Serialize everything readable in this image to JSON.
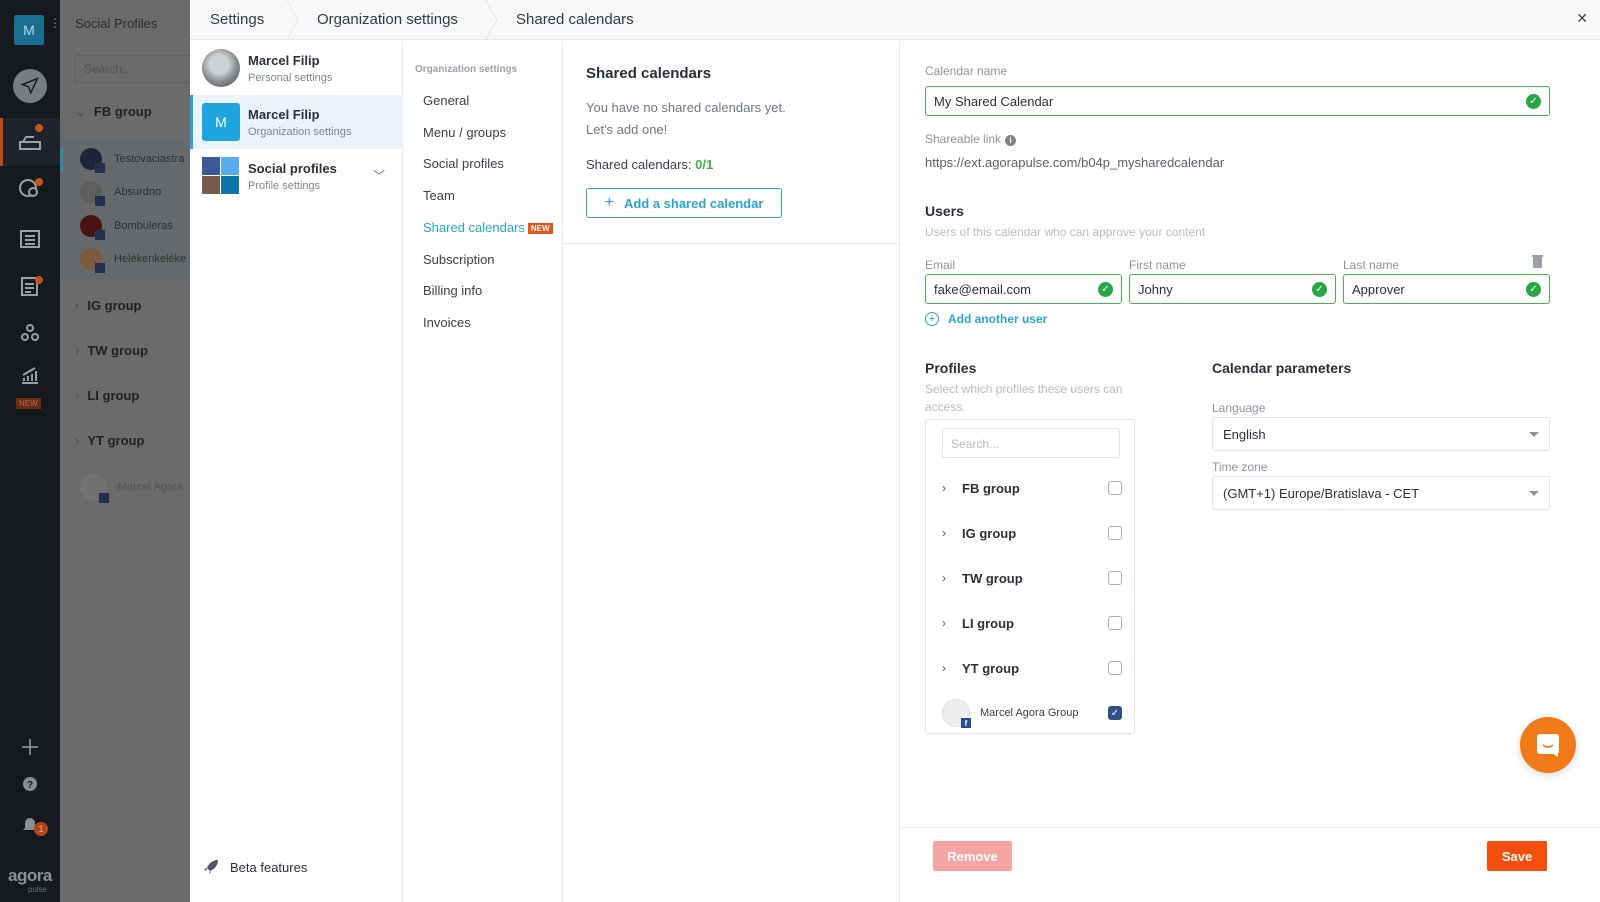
{
  "rail": {
    "workspace_initial": "M",
    "new_badge": "NEW",
    "notification_count": "1",
    "logo": "agora",
    "logo_sub": "pulse",
    "icons": [
      "publish-icon",
      "inbox-icon",
      "listening-icon",
      "calendar-icon",
      "reports-icon",
      "team-icon",
      "analytics-icon",
      "add-icon",
      "help-icon",
      "bell-icon"
    ]
  },
  "profiles_column": {
    "title": "Social Profiles",
    "search_placeholder": "Search...",
    "groups": [
      {
        "label": "FB group",
        "expanded": true
      },
      {
        "label": "IG group",
        "expanded": false
      },
      {
        "label": "TW group",
        "expanded": false
      },
      {
        "label": "LI group",
        "expanded": false
      },
      {
        "label": "YT group",
        "expanded": false
      }
    ],
    "fb_profiles": [
      "Testovaciastra",
      "Absurdno",
      "Bombuleras",
      "Helékenkelékе"
    ],
    "standalone_profile": "Marcel Agora"
  },
  "breadcrumb": [
    "Settings",
    "Organization settings",
    "Shared calendars"
  ],
  "accounts": [
    {
      "name": "Marcel Filip",
      "subtitle": "Personal settings",
      "active": false
    },
    {
      "name": "Marcel Filip",
      "subtitle": "Organization settings",
      "initial": "M",
      "active": true
    },
    {
      "name": "Social profiles",
      "subtitle": "Profile settings",
      "active": false
    }
  ],
  "beta_features": "Beta features",
  "org_nav": {
    "heading": "Organization settings",
    "items": [
      {
        "label": "General"
      },
      {
        "label": "Menu / groups"
      },
      {
        "label": "Social profiles"
      },
      {
        "label": "Team"
      },
      {
        "label": "Shared calendars",
        "badge": "NEW",
        "active": true
      },
      {
        "label": "Subscription"
      },
      {
        "label": "Billing info"
      },
      {
        "label": "Invoices"
      }
    ]
  },
  "shared_calendars": {
    "title": "Shared calendars",
    "empty_line1": "You have no shared calendars yet.",
    "empty_line2": "Let's add one!",
    "count_label": "Shared calendars:",
    "count_value": "0/1",
    "add_button": "Add a shared calendar"
  },
  "form": {
    "calendar_name_label": "Calendar name",
    "calendar_name_value": "My Shared Calendar",
    "shareable_link_label": "Shareable link",
    "shareable_link_value": "https://ext.agorapulse.com/b04p_mysharedcalendar",
    "users_title": "Users",
    "users_subtitle": "Users of this calendar who can approve your content",
    "email_label": "Email",
    "email_value": "fake@email.com",
    "first_name_label": "First name",
    "first_name_value": "Johny",
    "last_name_label": "Last name",
    "last_name_value": "Approver",
    "add_user": "Add another user",
    "profiles_title": "Profiles",
    "profiles_subtitle": "Select which profiles these users can access.",
    "profiles_search_placeholder": "Search...",
    "profile_groups": [
      {
        "label": "FB group",
        "checked": false
      },
      {
        "label": "IG group",
        "checked": false
      },
      {
        "label": "TW group",
        "checked": false
      },
      {
        "label": "LI group",
        "checked": false
      },
      {
        "label": "YT group",
        "checked": false
      }
    ],
    "profile_person": {
      "label": "Marcel Agora Group",
      "checked": true
    },
    "params_title": "Calendar parameters",
    "language_label": "Language",
    "language_value": "English",
    "timezone_label": "Time zone",
    "timezone_value": "(GMT+1) Europe/Bratislava - CET",
    "remove_button": "Remove",
    "save_button": "Save"
  },
  "colors": {
    "accent": "#2aa4cf",
    "success": "#27a745",
    "save": "#f24f0f",
    "remove": "#f5a3a3",
    "new_badge": "#e0531a",
    "chat": "#f07a18"
  }
}
